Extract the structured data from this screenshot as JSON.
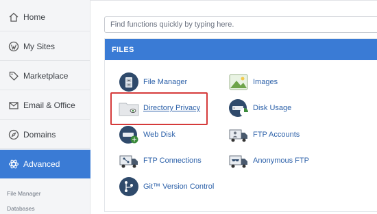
{
  "sidebar": {
    "items": [
      {
        "label": "Home",
        "icon": "home-icon"
      },
      {
        "label": "My Sites",
        "icon": "wordpress-icon"
      },
      {
        "label": "Marketplace",
        "icon": "tag-icon"
      },
      {
        "label": "Email & Office",
        "icon": "envelope-icon"
      },
      {
        "label": "Domains",
        "icon": "compass-icon"
      },
      {
        "label": "Advanced",
        "icon": "atom-icon",
        "active": true
      }
    ],
    "sub_links": [
      "File Manager",
      "Databases"
    ]
  },
  "search": {
    "placeholder": "Find functions quickly by typing here."
  },
  "files": {
    "header": "FILES",
    "items": [
      {
        "label": "File Manager",
        "icon": "file-cabinet-icon"
      },
      {
        "label": "Images",
        "icon": "image-icon"
      },
      {
        "label": "Directory Privacy",
        "icon": "folder-eye-icon"
      },
      {
        "label": "Disk Usage",
        "icon": "disk-usage-icon"
      },
      {
        "label": "Web Disk",
        "icon": "web-disk-icon"
      },
      {
        "label": "FTP Accounts",
        "icon": "ftp-truck-icon"
      },
      {
        "label": "FTP Connections",
        "icon": "ftp-connections-icon"
      },
      {
        "label": "Anonymous FTP",
        "icon": "anonymous-ftp-icon"
      },
      {
        "label": "Git™ Version Control",
        "icon": "git-icon"
      }
    ]
  },
  "colors": {
    "accent": "#3a7bd5",
    "highlight": "#d53a3a",
    "link": "#2a5fa8"
  }
}
